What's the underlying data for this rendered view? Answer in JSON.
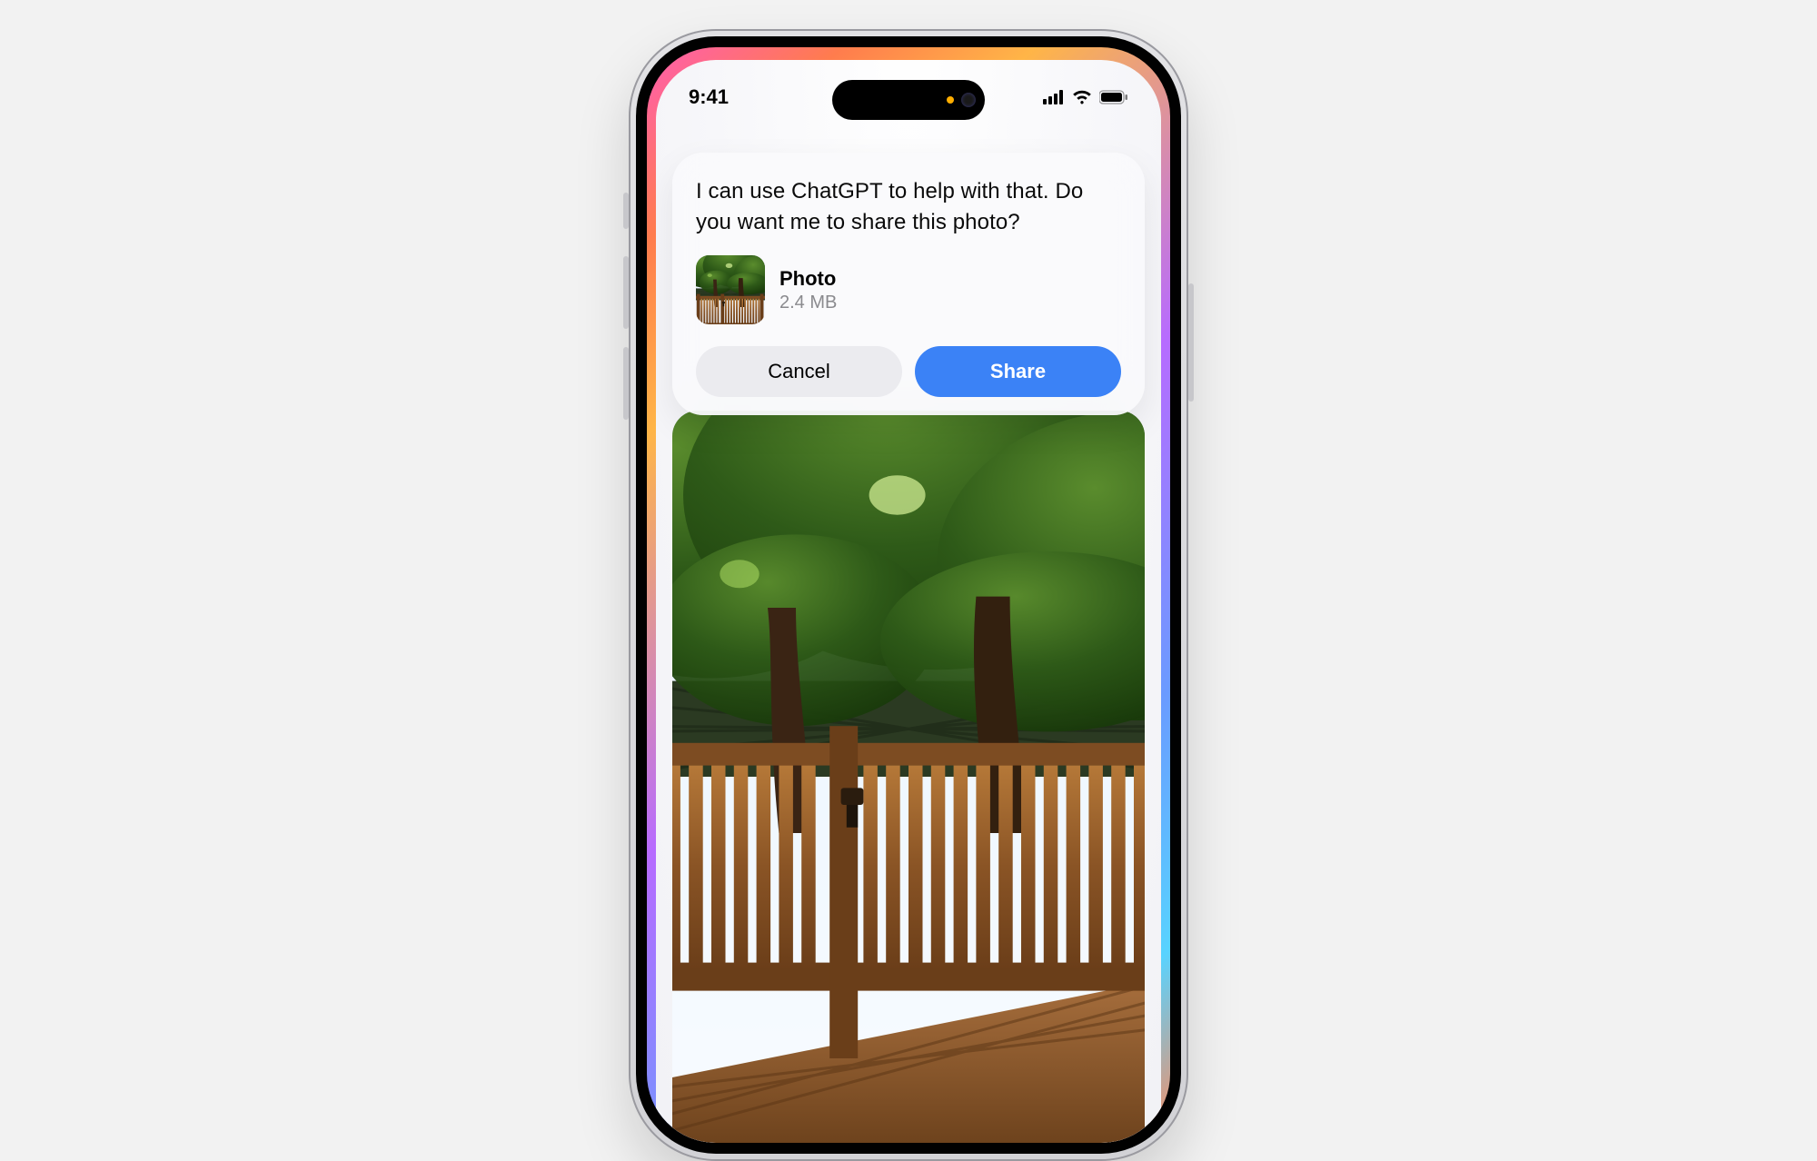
{
  "status": {
    "time": "9:41"
  },
  "prompt": {
    "message": "I can use ChatGPT to help with that. Do you want me to share this photo?",
    "attachment": {
      "name": "Photo",
      "size": "2.4 MB"
    },
    "cancel_label": "Cancel",
    "share_label": "Share"
  }
}
